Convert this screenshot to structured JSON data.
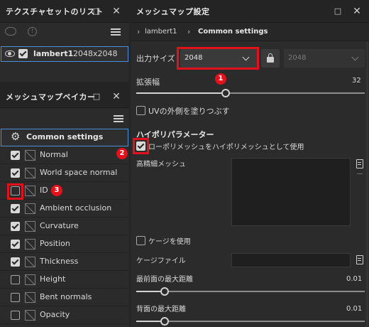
{
  "texture_sets": {
    "title": "テクスチャセットのリスト",
    "item_name": "lambert1",
    "item_size": "2048x2048"
  },
  "baker": {
    "title": "メッシュマップベイカー",
    "common_settings": "Common settings",
    "maps": [
      {
        "label": "Normal",
        "checked": true
      },
      {
        "label": "World space normal",
        "checked": true
      },
      {
        "label": "ID",
        "checked": false
      },
      {
        "label": "Ambient occlusion",
        "checked": true
      },
      {
        "label": "Curvature",
        "checked": true
      },
      {
        "label": "Position",
        "checked": true
      },
      {
        "label": "Thickness",
        "checked": true
      },
      {
        "label": "Height",
        "checked": false
      },
      {
        "label": "Bent normals",
        "checked": false
      },
      {
        "label": "Opacity",
        "checked": false
      }
    ]
  },
  "settings": {
    "title": "メッシュマップ設定",
    "breadcrumb_1": "lambert1",
    "breadcrumb_2": "Common settings",
    "output_size_label": "出力サイズ",
    "output_size_value": "2048",
    "output_size_locked_value": "2048",
    "dilation_label": "拡張幅",
    "dilation_value": "32",
    "dilation_fraction": 0.39,
    "fill_uv_label": "UVの外側を塗りつぶす",
    "high_poly_header": "ハイポリパラメーター",
    "use_low_as_high_label": "ローポリメッシュをハイポリメッシュとして使用",
    "high_mesh_label": "高精細メッシュ",
    "use_cage_label": "ケージを使用",
    "cage_file_label": "ケージファイル",
    "front_distance_label": "最前面の最大距離",
    "front_distance_value": "0.01",
    "rear_distance_label": "背面の最大距離",
    "rear_distance_value": "0.01"
  },
  "annotations": {
    "badge_1": "1",
    "badge_2": "2",
    "badge_3": "3"
  },
  "colors": {
    "highlight": "#e2121c",
    "selected_outline": "#4a90d9"
  }
}
